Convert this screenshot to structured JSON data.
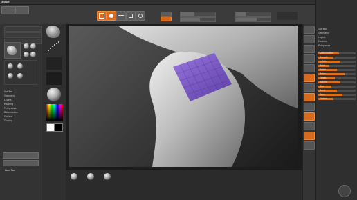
{
  "menubar": {
    "items": [
      "Brush"
    ]
  },
  "toolbar": {
    "buttons": [
      {
        "label": "Edit",
        "icon": "edit-icon"
      },
      {
        "label": "Draw",
        "icon": "draw-icon"
      },
      {
        "label": "Move",
        "icon": "move-icon"
      },
      {
        "label": "Scale",
        "icon": "scale-icon"
      },
      {
        "label": "Rotate",
        "icon": "rotate-icon"
      }
    ],
    "sliders": [
      {
        "label": "Draw Size",
        "value": 0.4
      },
      {
        "label": "Z Intensity",
        "value": 0.55
      }
    ]
  },
  "left_panel": {
    "title": "Brush",
    "rows": [
      "SubTool",
      "Geometry",
      "Layers",
      "Masking",
      "Polygroups",
      "Deformation",
      "Surface",
      "Display"
    ],
    "bottom_buttons": [
      "Lightbox",
      "Load Tool"
    ]
  },
  "mid_left": {
    "color_swatch_main": "#ffffff",
    "color_swatch_secondary": "#000000"
  },
  "viewport": {
    "accent_mask_color": "#7b52c9"
  },
  "bottom_shelf": {
    "items": [
      "brush-1",
      "brush-2",
      "brush-3"
    ]
  },
  "right_panel": {
    "rows": [
      "SubTool",
      "Geometry",
      "Layers",
      "Masking",
      "Polygroups",
      "Deformation",
      "Surface",
      "Display",
      "Gizmo",
      "Preview"
    ],
    "slider_rows": [
      {
        "label": "Deformation",
        "value": 0.55
      },
      {
        "label": "Smooth",
        "value": 0.4
      },
      {
        "label": "Inflate",
        "value": 0.6
      },
      {
        "label": "Twist",
        "value": 0.3
      },
      {
        "label": "Polish",
        "value": 0.5
      },
      {
        "label": "Relax",
        "value": 0.7
      },
      {
        "label": "Offset",
        "value": 0.45
      },
      {
        "label": "Rotate",
        "value": 0.6
      },
      {
        "label": "Size",
        "value": 0.35
      },
      {
        "label": "Bend",
        "value": 0.5
      },
      {
        "label": "Taper",
        "value": 0.65
      },
      {
        "label": "Flatten",
        "value": 0.4
      }
    ]
  },
  "colors": {
    "accent": "#d86a1e",
    "mask": "#7b52c9"
  }
}
